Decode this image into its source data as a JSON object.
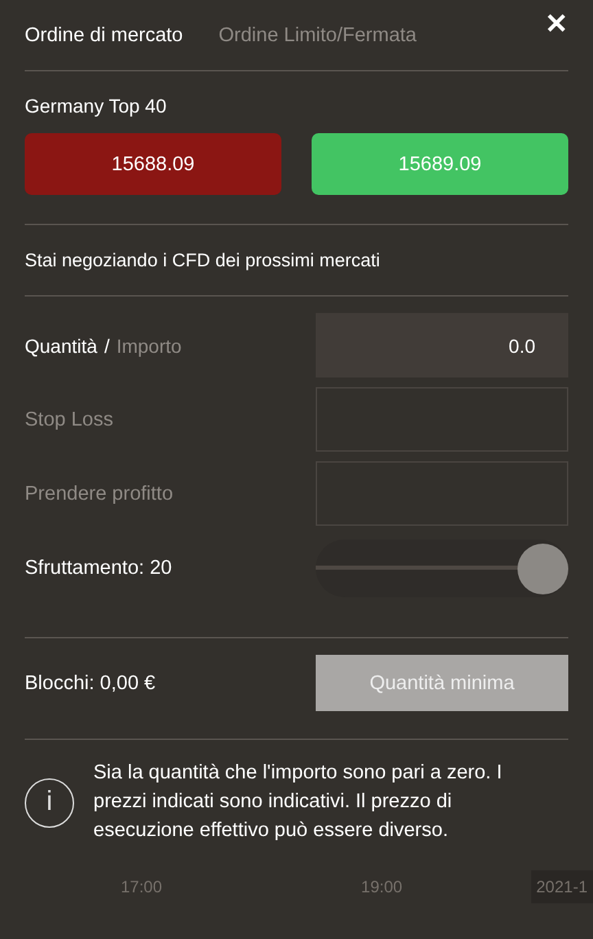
{
  "tabs": [
    {
      "label": "Ordine di mercato",
      "selected": true
    },
    {
      "label": "Ordine Limito/Fermata",
      "selected": false
    }
  ],
  "close": "✕",
  "instrument": "Germany Top 40",
  "prices": [
    {
      "kind": "sell",
      "label": "15688.09"
    },
    {
      "kind": "buy",
      "label": "15689.09"
    }
  ],
  "notice": "Stai negoziando i CFD dei prossimi mercati",
  "quantity": {
    "modes": [
      {
        "label": "Quantità",
        "selected": true
      },
      {
        "label": "Importo",
        "selected": false
      }
    ],
    "separator": "/",
    "value": "0.0"
  },
  "fields": [
    {
      "label": "Stop Loss",
      "disabled": true
    },
    {
      "label": "Prendere profitto",
      "disabled": true
    }
  ],
  "leverage": {
    "label": "Sfruttamento: 20",
    "level": 1
  },
  "blocks": {
    "label": "Blocchi: 0,00 €",
    "button": "Quantità minima",
    "disabled": true
  },
  "info": {
    "icon": "i",
    "text": "Sia la quantità che l'importo sono pari a zero. I prezzi indicati sono indicativi. Il prezzo di esecuzione effettivo può essere diverso."
  },
  "axis": [
    "17:00",
    "19:00"
  ],
  "axis_date": "2021-1"
}
